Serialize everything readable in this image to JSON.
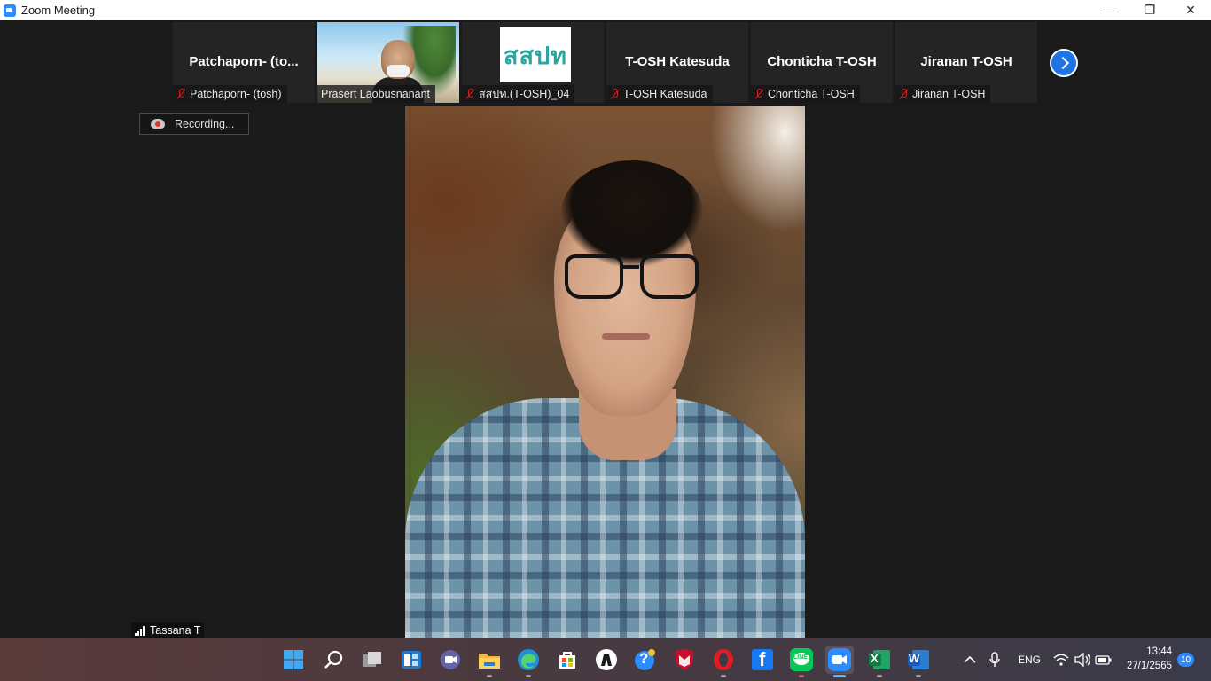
{
  "window": {
    "title": "Zoom Meeting",
    "controls": {
      "minimize": "—",
      "restore": "❐",
      "close": "✕"
    }
  },
  "participants": [
    {
      "big_name": "Patchaporn- (to...",
      "label": "Patchaporn- (tosh)",
      "muted": true,
      "video": "name"
    },
    {
      "big_name": "",
      "label": "Prasert Laobusnanant",
      "muted": false,
      "video": "camera"
    },
    {
      "big_name": "",
      "label": "สสปท.(T-OSH)_04",
      "muted": true,
      "video": "logo",
      "logo_text": "สสปท"
    },
    {
      "big_name": "T-OSH Katesuda",
      "label": "T-OSH Katesuda",
      "muted": true,
      "video": "name"
    },
    {
      "big_name": "Chonticha T-OSH",
      "label": "Chonticha T-OSH",
      "muted": true,
      "video": "name"
    },
    {
      "big_name": "Jiranan T-OSH",
      "label": "Jiranan T-OSH",
      "muted": true,
      "video": "name"
    }
  ],
  "recording": {
    "label": "Recording..."
  },
  "active_speaker": {
    "name": "Tassana T"
  },
  "taskbar": {
    "icons": [
      "windows-start-icon",
      "search-icon",
      "task-view-icon",
      "widgets-icon",
      "teams-chat-icon",
      "file-explorer-icon",
      "edge-icon",
      "store-icon",
      "app-icon",
      "help-icon",
      "mcafee-icon",
      "opera-icon",
      "facebook-icon",
      "line-icon",
      "zoom-icon",
      "excel-icon",
      "word-icon"
    ],
    "line_label": "LINE",
    "excel_label": "X",
    "word_label": "W",
    "facebook_label": "f",
    "help_label": "?",
    "tray": {
      "language": "ENG",
      "time": "13:44",
      "date": "27/1/2565",
      "notifications": "10"
    }
  },
  "colors": {
    "accent": "#2d8cff",
    "muted_mic": "#e02020",
    "tile_bg": "#242424",
    "meeting_bg": "#1a1a1a"
  }
}
